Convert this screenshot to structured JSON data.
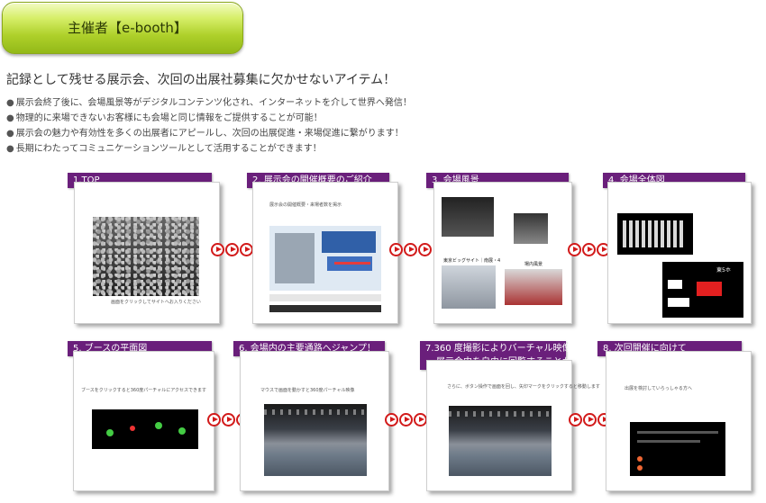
{
  "header": {
    "title": "主催者【e-booth】"
  },
  "headline": "記録として残せる展示会、次回の出展社募集に欠かせないアイテム！",
  "bullets": [
    "展示会終了後に、会場風景等がデジタルコンテンツ化され、インターネットを介して世界へ発信！",
    "物理的に来場できないお客様にも会場と同じ情報をご提供することが可能！",
    "展示会の魅力や有効性を多くの出展者にアピールし、次回の出展促進・来場促進に繋がります！",
    "長期にわたってコミュニケーションツールとして活用することができます！"
  ],
  "steps": [
    {
      "title": "1.TOP",
      "caption": "画面をクリックしてサイトへお入りください"
    },
    {
      "title": "2. 展示会の開催概要のご紹介",
      "caption": "展示会の開催概要・来場者数を掲示"
    },
    {
      "title": "3. 会場風景",
      "photo_label_1": "東京ビッグサイト｜南展・4",
      "photo_label_2": "場内風景"
    },
    {
      "title": "4. 会場全体図",
      "hall_label": "東5ホ"
    },
    {
      "title": "5. ブースの平面図",
      "caption": "ブースをクリックすると360度パーチャルにアクセスできます"
    },
    {
      "title": "6. 会場内の主要通路へジャンプ！",
      "caption": "マウスで画面を動かすと360度パーチャル映像"
    },
    {
      "title_line1": "7.360 度撮影によりバーチャル映像",
      "title_line2": "展示会内を自由に回覧することが可能",
      "caption": "さらに、ボタン操作で画面を回し、矢印マークをクリックすると移動します"
    },
    {
      "title": "8. 次回開催に向けて",
      "caption": "出展を検討していらっしゃる方へ"
    }
  ],
  "colors": {
    "step_title_bg": "#6a1f7b",
    "arrow": "#d21a1a",
    "header_green": "#aed02a"
  }
}
